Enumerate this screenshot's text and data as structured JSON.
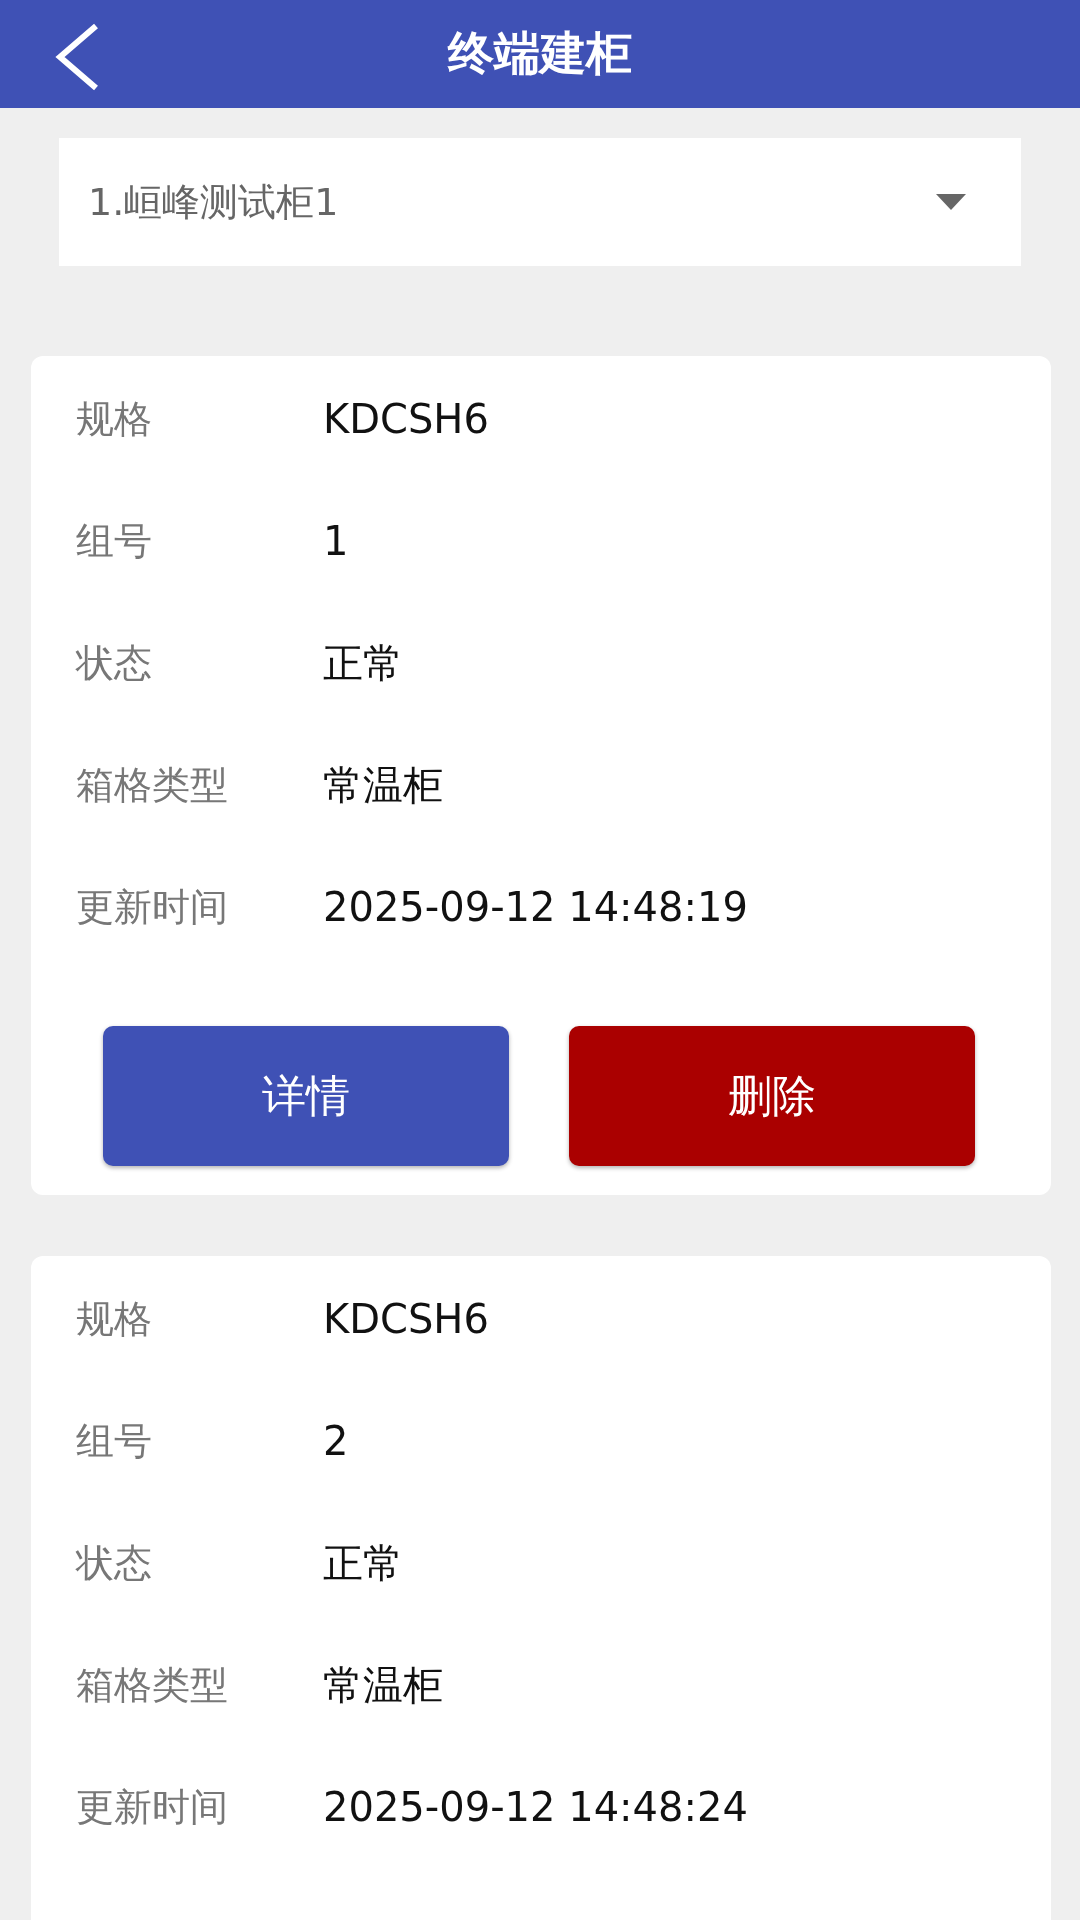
{
  "header": {
    "title": "终端建柜"
  },
  "select": {
    "value": "1.峘峰测试柜1"
  },
  "cards": [
    {
      "fields": [
        {
          "label": "规格",
          "value": "KDCSH6"
        },
        {
          "label": "组号",
          "value": "1"
        },
        {
          "label": "状态",
          "value": "正常"
        },
        {
          "label": "箱格类型",
          "value": "常温柜"
        },
        {
          "label": "更新时间",
          "value": "2025-09-12 14:48:19"
        }
      ],
      "buttons": [
        {
          "label": "详情",
          "kind": "primary"
        },
        {
          "label": "删除",
          "kind": "danger"
        }
      ]
    },
    {
      "fields": [
        {
          "label": "规格",
          "value": "KDCSH6"
        },
        {
          "label": "组号",
          "value": "2"
        },
        {
          "label": "状态",
          "value": "正常"
        },
        {
          "label": "箱格类型",
          "value": "常温柜"
        },
        {
          "label": "更新时间",
          "value": "2025-09-12 14:48:24"
        }
      ]
    }
  ]
}
